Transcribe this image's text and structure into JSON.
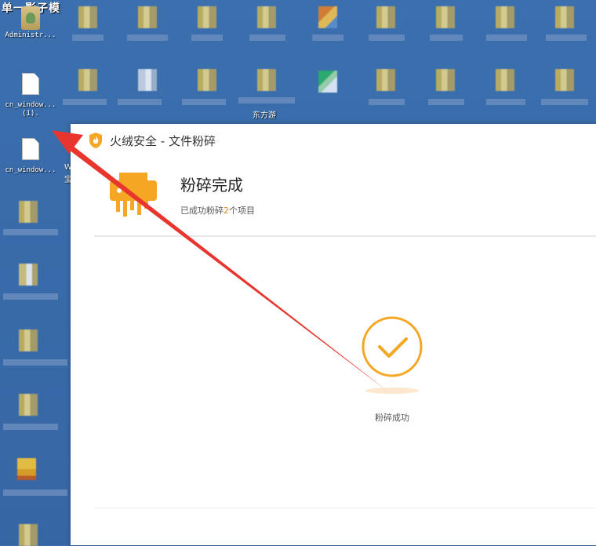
{
  "desktop": {
    "top_title": "单一影子模",
    "icons": [
      {
        "id": "admin",
        "label": "Administr..."
      },
      {
        "id": "file1",
        "label": "cn_window...\n(1)."
      },
      {
        "id": "file2",
        "label": "cn_window..."
      }
    ],
    "partial_labels": [
      "W",
      "宝",
      "东方游"
    ]
  },
  "window": {
    "title": "火绒安全 - 文件粉碎",
    "result_title": "粉碎完成",
    "result_sub_prefix": "已成功粉碎",
    "result_count": "2",
    "result_sub_suffix": "个项目",
    "success_label": "粉碎成功"
  },
  "colors": {
    "accent": "#f5a623",
    "desktop": "#3b6fae",
    "arrow": "#e8362f"
  },
  "icons": {
    "app_logo": "huorong-shield-icon",
    "shredder": "shredder-icon",
    "success": "check-circle-icon",
    "arrow": "red-arrow-annotation"
  }
}
